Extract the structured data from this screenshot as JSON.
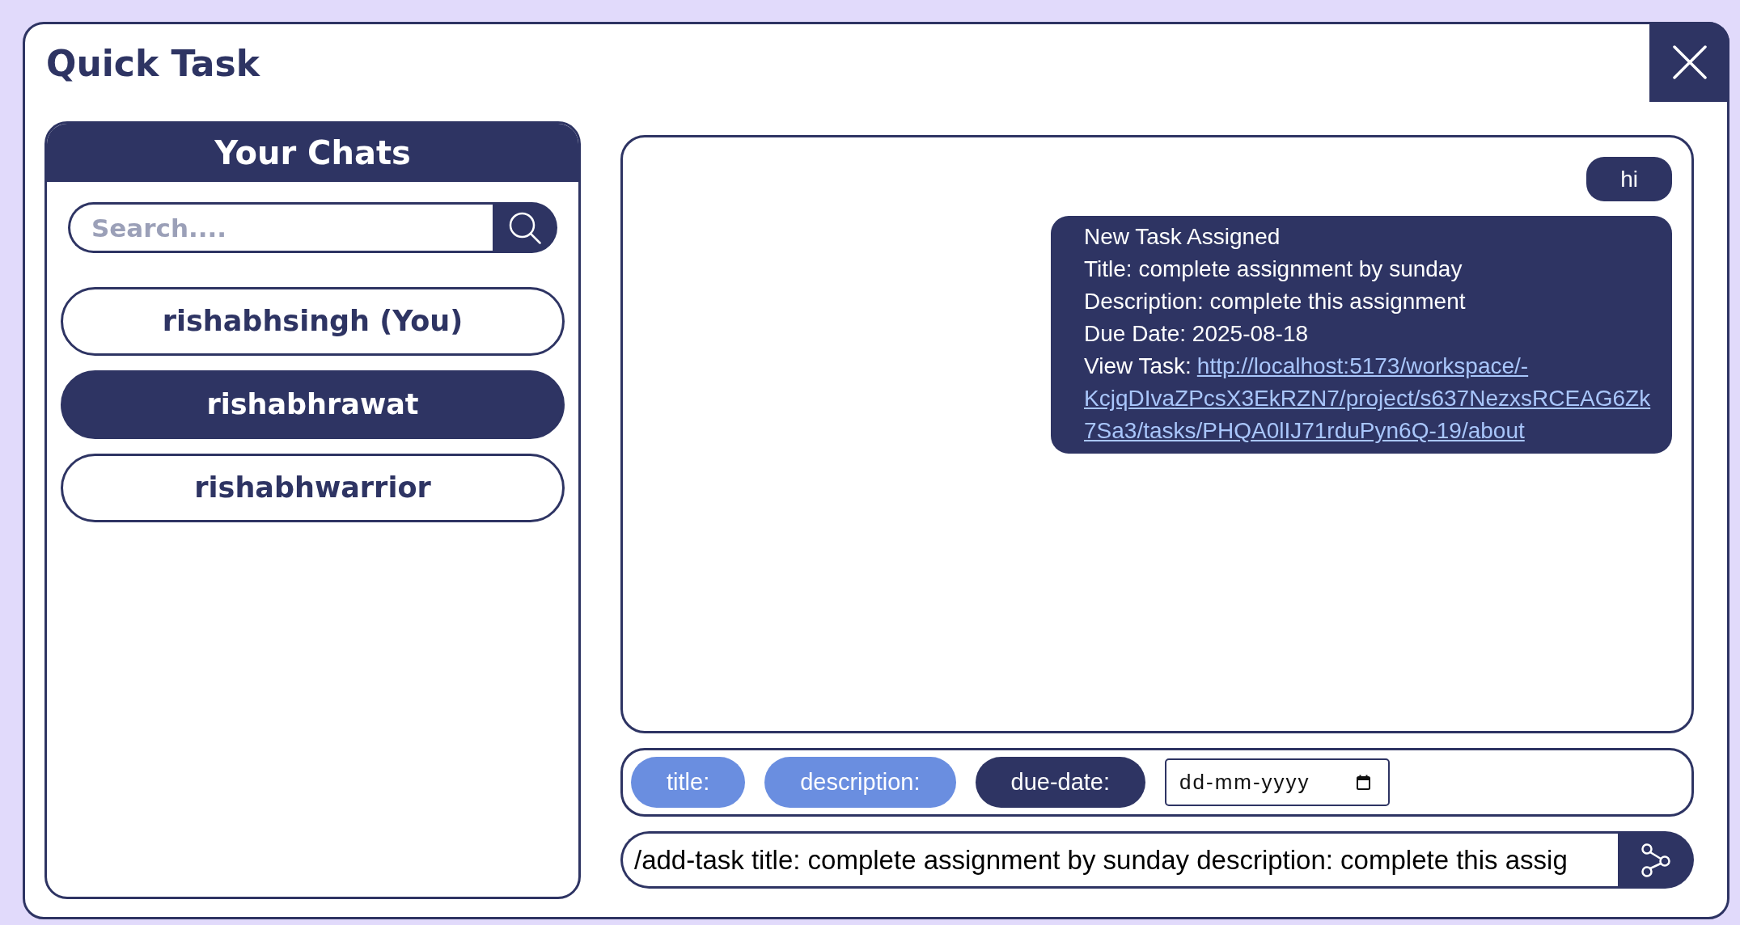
{
  "window": {
    "title": "Quick Task"
  },
  "chats_panel": {
    "title": "Your Chats",
    "search": {
      "placeholder": "Search...."
    },
    "items": [
      {
        "label": "rishabhsingh (You)",
        "selected": false
      },
      {
        "label": "rishabhrawat",
        "selected": true
      },
      {
        "label": "rishabhwarrior",
        "selected": false
      }
    ]
  },
  "conversation": {
    "messages": [
      {
        "kind": "text",
        "text": "hi"
      },
      {
        "kind": "task",
        "lines": [
          "New Task Assigned",
          "Title: complete assignment by sunday",
          "Description: complete this assignment",
          "Due Date: 2025-08-18"
        ],
        "link_label": "View Task:",
        "link_lines": [
          "http://localhost:5173/workspace/-",
          "KcjqDIvaZPcsX3EkRZN7/project/s637NezxsRCEAG6Zk",
          "7Sa3/tasks/PHQA0lIJ71rduPyn6Q-19/about"
        ]
      }
    ]
  },
  "field_chips": [
    {
      "label": "title:",
      "active": true
    },
    {
      "label": "description:",
      "active": true
    },
    {
      "label": "due-date:",
      "active": false
    }
  ],
  "date_field": {
    "placeholder": "dd-mm-yyyy"
  },
  "composer": {
    "value": "/add-task title: complete assignment by sunday description: complete this assig"
  }
}
